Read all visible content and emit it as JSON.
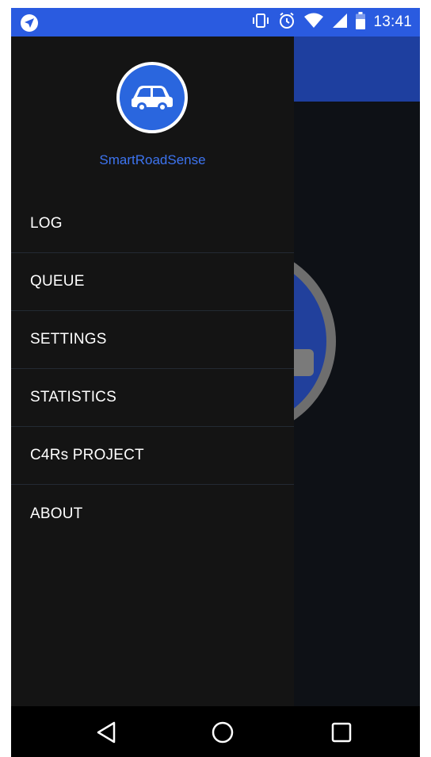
{
  "status_bar": {
    "time": "13:41",
    "icons": [
      "navigation-arrow-icon",
      "vibrate-icon",
      "alarm-icon",
      "wifi-icon",
      "signal-icon",
      "battery-icon"
    ]
  },
  "drawer": {
    "app_name": "SmartRoadSense",
    "logo_icon": "car-icon",
    "menu": [
      {
        "label": "LOG"
      },
      {
        "label": "QUEUE"
      },
      {
        "label": "SETTINGS"
      },
      {
        "label": "STATISTICS"
      },
      {
        "label": "C4Rs PROJECT"
      },
      {
        "label": "ABOUT"
      }
    ]
  },
  "nav_bar": {
    "icons": [
      "back-icon",
      "home-icon",
      "recents-icon"
    ]
  },
  "colors": {
    "status_bar": "#2a5be0",
    "toolbar": "#1e3f9f",
    "drawer_bg": "#141414",
    "accent": "#3d74f0"
  }
}
